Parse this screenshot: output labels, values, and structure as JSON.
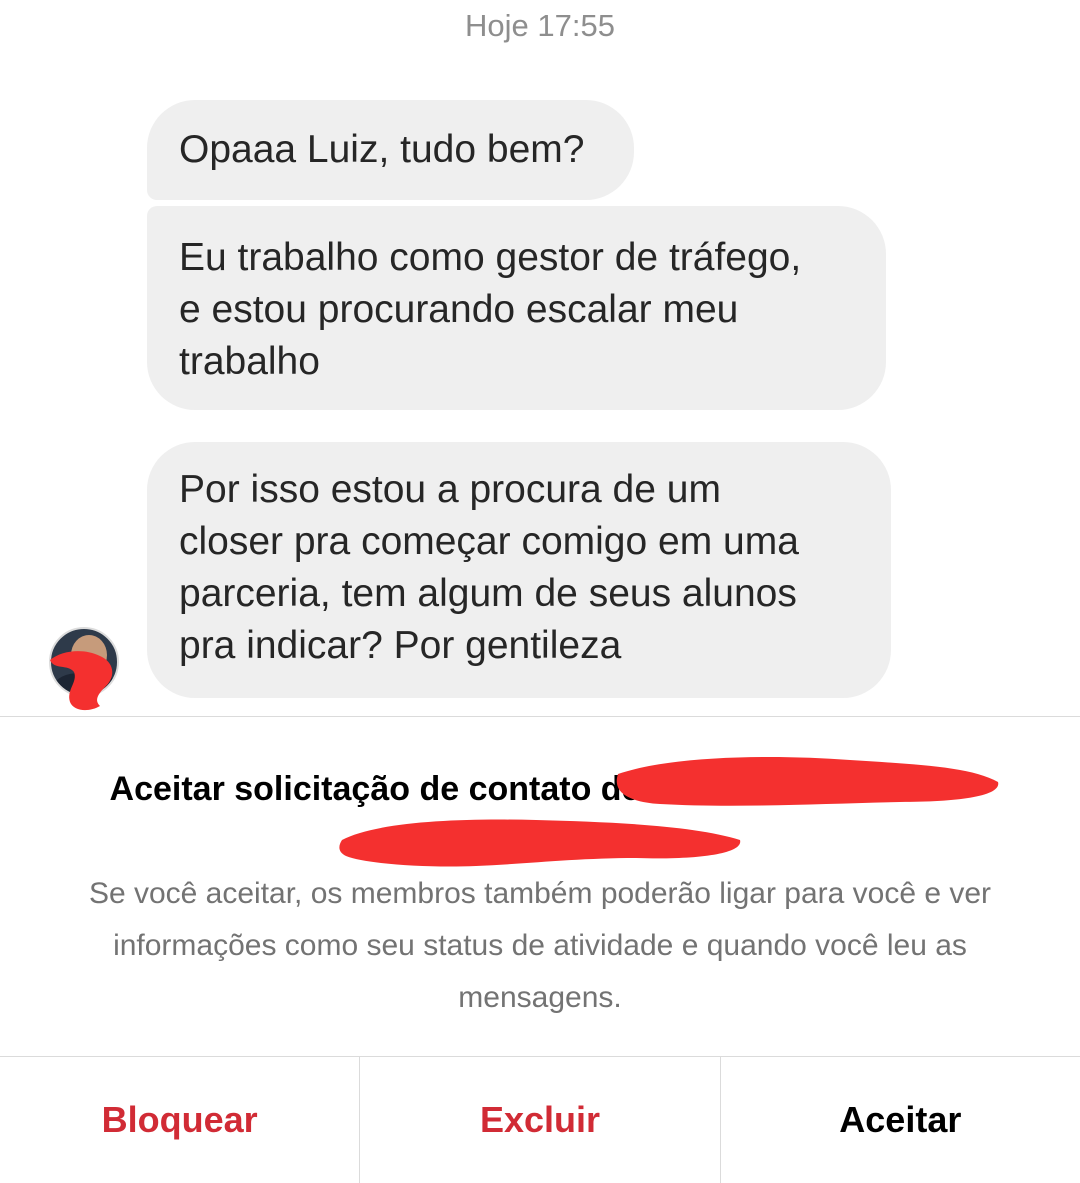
{
  "thread": {
    "timestamp": "Hoje 17:55",
    "messages": [
      {
        "text": "Opaaa Luiz, tudo bem?"
      },
      {
        "text": "Eu trabalho como gestor de tráfego,\ne estou procurando escalar meu\ntrabalho"
      },
      {
        "text": "Por isso estou a procura de um\ncloser pra começar comigo em uma\nparceria, tem algum de seus alunos\npra indicar? Por gentileza"
      }
    ]
  },
  "request": {
    "title_prefix": "Aceitar solicitação de contato de",
    "description": "Se você aceitar, os membros também poderão ligar para você e ver informações como seu status de atividade e quando você leu as mensagens."
  },
  "actions": {
    "block_label": "Bloquear",
    "delete_label": "Excluir",
    "accept_label": "Aceitar"
  },
  "colors": {
    "bubble_bg": "#efefef",
    "danger": "#d12b35",
    "redaction": "#f4302f",
    "muted_text": "#737373"
  }
}
